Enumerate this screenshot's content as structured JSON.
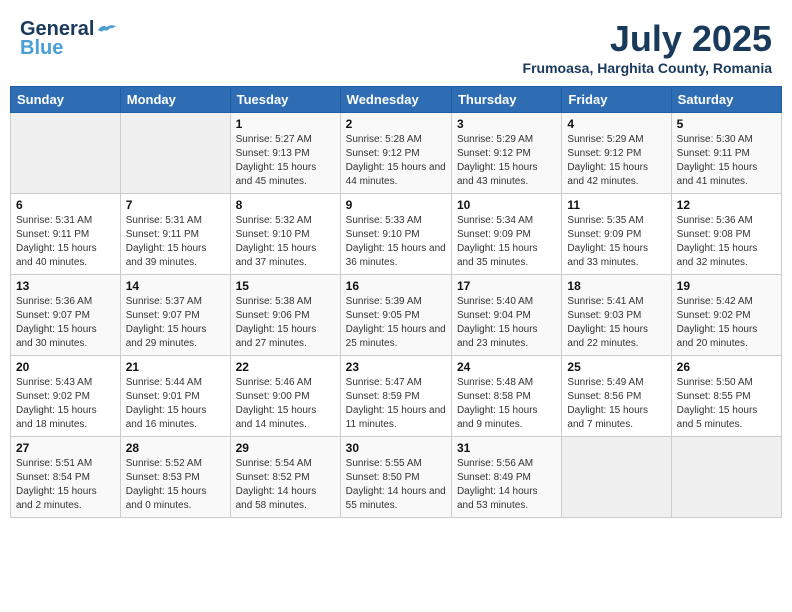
{
  "header": {
    "logo_line1": "General",
    "logo_line2": "Blue",
    "title": "July 2025",
    "subtitle": "Frumoasa, Harghita County, Romania"
  },
  "weekdays": [
    "Sunday",
    "Monday",
    "Tuesday",
    "Wednesday",
    "Thursday",
    "Friday",
    "Saturday"
  ],
  "weeks": [
    [
      {
        "day": "",
        "info": ""
      },
      {
        "day": "",
        "info": ""
      },
      {
        "day": "1",
        "info": "Sunrise: 5:27 AM\nSunset: 9:13 PM\nDaylight: 15 hours and 45 minutes."
      },
      {
        "day": "2",
        "info": "Sunrise: 5:28 AM\nSunset: 9:12 PM\nDaylight: 15 hours and 44 minutes."
      },
      {
        "day": "3",
        "info": "Sunrise: 5:29 AM\nSunset: 9:12 PM\nDaylight: 15 hours and 43 minutes."
      },
      {
        "day": "4",
        "info": "Sunrise: 5:29 AM\nSunset: 9:12 PM\nDaylight: 15 hours and 42 minutes."
      },
      {
        "day": "5",
        "info": "Sunrise: 5:30 AM\nSunset: 9:11 PM\nDaylight: 15 hours and 41 minutes."
      }
    ],
    [
      {
        "day": "6",
        "info": "Sunrise: 5:31 AM\nSunset: 9:11 PM\nDaylight: 15 hours and 40 minutes."
      },
      {
        "day": "7",
        "info": "Sunrise: 5:31 AM\nSunset: 9:11 PM\nDaylight: 15 hours and 39 minutes."
      },
      {
        "day": "8",
        "info": "Sunrise: 5:32 AM\nSunset: 9:10 PM\nDaylight: 15 hours and 37 minutes."
      },
      {
        "day": "9",
        "info": "Sunrise: 5:33 AM\nSunset: 9:10 PM\nDaylight: 15 hours and 36 minutes."
      },
      {
        "day": "10",
        "info": "Sunrise: 5:34 AM\nSunset: 9:09 PM\nDaylight: 15 hours and 35 minutes."
      },
      {
        "day": "11",
        "info": "Sunrise: 5:35 AM\nSunset: 9:09 PM\nDaylight: 15 hours and 33 minutes."
      },
      {
        "day": "12",
        "info": "Sunrise: 5:36 AM\nSunset: 9:08 PM\nDaylight: 15 hours and 32 minutes."
      }
    ],
    [
      {
        "day": "13",
        "info": "Sunrise: 5:36 AM\nSunset: 9:07 PM\nDaylight: 15 hours and 30 minutes."
      },
      {
        "day": "14",
        "info": "Sunrise: 5:37 AM\nSunset: 9:07 PM\nDaylight: 15 hours and 29 minutes."
      },
      {
        "day": "15",
        "info": "Sunrise: 5:38 AM\nSunset: 9:06 PM\nDaylight: 15 hours and 27 minutes."
      },
      {
        "day": "16",
        "info": "Sunrise: 5:39 AM\nSunset: 9:05 PM\nDaylight: 15 hours and 25 minutes."
      },
      {
        "day": "17",
        "info": "Sunrise: 5:40 AM\nSunset: 9:04 PM\nDaylight: 15 hours and 23 minutes."
      },
      {
        "day": "18",
        "info": "Sunrise: 5:41 AM\nSunset: 9:03 PM\nDaylight: 15 hours and 22 minutes."
      },
      {
        "day": "19",
        "info": "Sunrise: 5:42 AM\nSunset: 9:02 PM\nDaylight: 15 hours and 20 minutes."
      }
    ],
    [
      {
        "day": "20",
        "info": "Sunrise: 5:43 AM\nSunset: 9:02 PM\nDaylight: 15 hours and 18 minutes."
      },
      {
        "day": "21",
        "info": "Sunrise: 5:44 AM\nSunset: 9:01 PM\nDaylight: 15 hours and 16 minutes."
      },
      {
        "day": "22",
        "info": "Sunrise: 5:46 AM\nSunset: 9:00 PM\nDaylight: 15 hours and 14 minutes."
      },
      {
        "day": "23",
        "info": "Sunrise: 5:47 AM\nSunset: 8:59 PM\nDaylight: 15 hours and 11 minutes."
      },
      {
        "day": "24",
        "info": "Sunrise: 5:48 AM\nSunset: 8:58 PM\nDaylight: 15 hours and 9 minutes."
      },
      {
        "day": "25",
        "info": "Sunrise: 5:49 AM\nSunset: 8:56 PM\nDaylight: 15 hours and 7 minutes."
      },
      {
        "day": "26",
        "info": "Sunrise: 5:50 AM\nSunset: 8:55 PM\nDaylight: 15 hours and 5 minutes."
      }
    ],
    [
      {
        "day": "27",
        "info": "Sunrise: 5:51 AM\nSunset: 8:54 PM\nDaylight: 15 hours and 2 minutes."
      },
      {
        "day": "28",
        "info": "Sunrise: 5:52 AM\nSunset: 8:53 PM\nDaylight: 15 hours and 0 minutes."
      },
      {
        "day": "29",
        "info": "Sunrise: 5:54 AM\nSunset: 8:52 PM\nDaylight: 14 hours and 58 minutes."
      },
      {
        "day": "30",
        "info": "Sunrise: 5:55 AM\nSunset: 8:50 PM\nDaylight: 14 hours and 55 minutes."
      },
      {
        "day": "31",
        "info": "Sunrise: 5:56 AM\nSunset: 8:49 PM\nDaylight: 14 hours and 53 minutes."
      },
      {
        "day": "",
        "info": ""
      },
      {
        "day": "",
        "info": ""
      }
    ]
  ]
}
